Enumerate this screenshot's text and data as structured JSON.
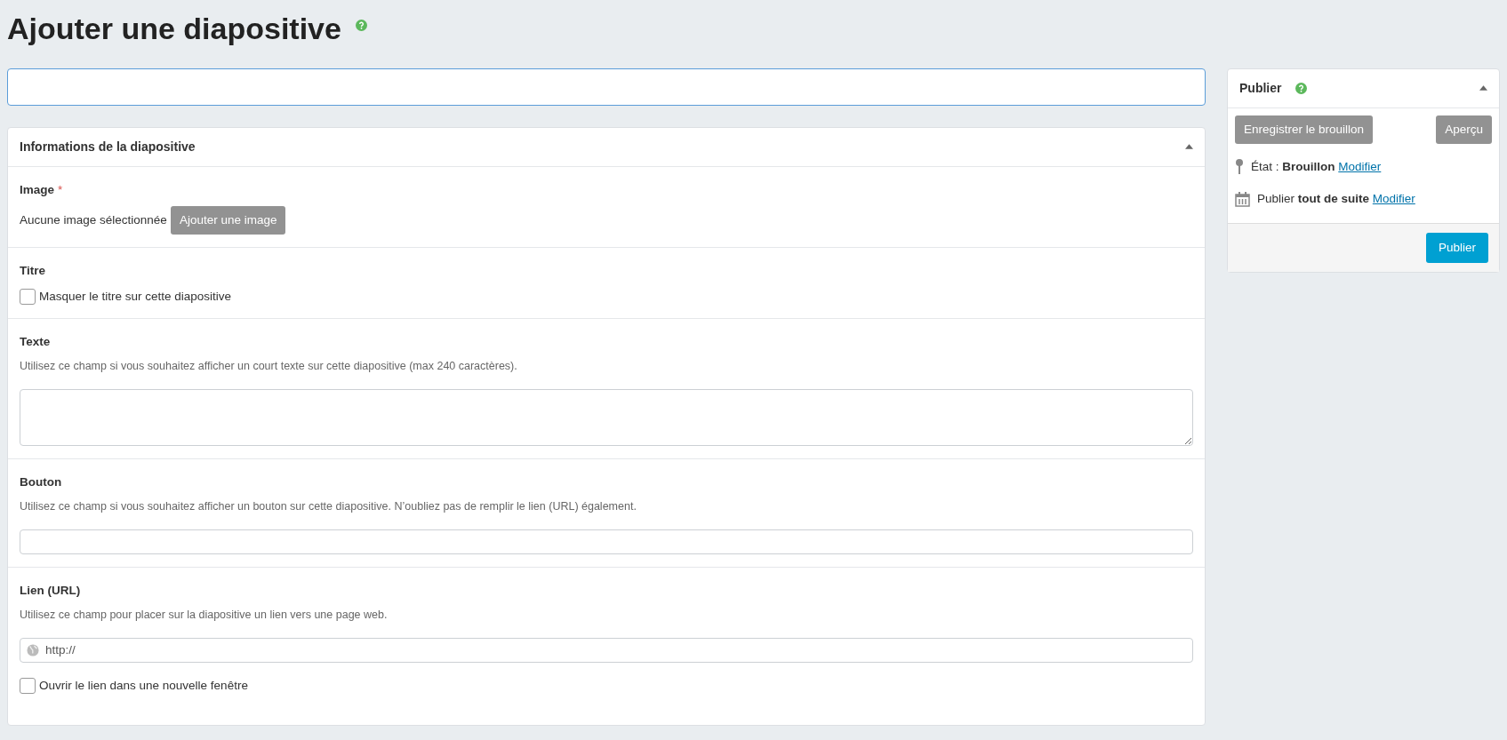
{
  "page_title": "Ajouter une diapositive",
  "slide_info": {
    "title": "Informations de la diapositive",
    "expanded": true,
    "sections": [
      {
        "kind": "image",
        "label": "Image",
        "required": true,
        "required_mark": "*",
        "status": "Aucune image sélectionnée",
        "button": "Ajouter une image"
      },
      {
        "kind": "checkbox",
        "label": "Titre",
        "option": {
          "label": "Masquer le titre sur cette diapositive",
          "checked": false
        }
      },
      {
        "kind": "textarea",
        "label": "Texte",
        "help": "Utilisez ce champ si vous souhaitez afficher un court texte sur cette diapositive (max 240 caractères)."
      },
      {
        "kind": "input",
        "label": "Bouton",
        "help": "Utilisez ce champ si vous souhaitez afficher un bouton sur cette diapositive. N’oubliez pas de remplir le lien (URL) également."
      },
      {
        "kind": "url",
        "label": "Lien (URL)",
        "help": "Utilisez ce champ pour placer sur la diapositive un lien vers une page web.",
        "placeholder": "http://",
        "option": {
          "label": "Ouvrir le lien dans une nouvelle fenêtre",
          "checked": false
        }
      }
    ]
  },
  "publish": {
    "title": "Publier",
    "expanded": true,
    "buttons": [
      {
        "label": "Enregistrer le brouillon",
        "disabled": true
      },
      {
        "label": "Aperçu",
        "disabled": true
      }
    ],
    "status": {
      "label": "État :",
      "value": "Brouillon",
      "link": "Modifier"
    },
    "schedule": {
      "label": "Publier",
      "value": "tout de suite",
      "link": "Modifier"
    },
    "submit": "Publier"
  }
}
